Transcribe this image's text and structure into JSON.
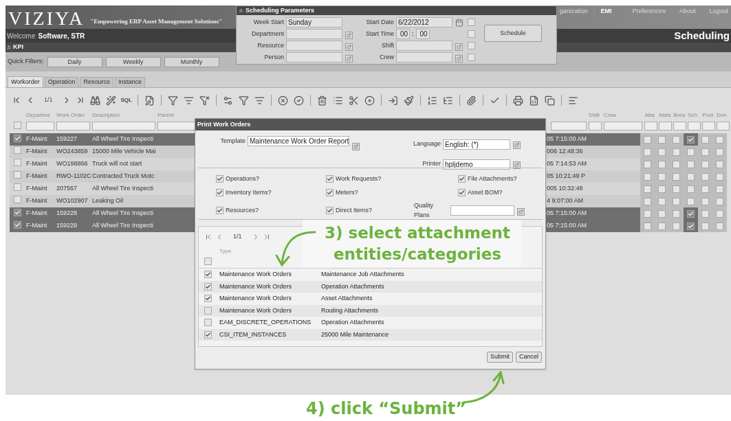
{
  "header": {
    "logo": "VIZIYA",
    "tagline": "\"Empowering ERP Asset Management Solutions\"",
    "org_label": "ganization",
    "org_separator": ":",
    "org_value": "EMI",
    "links": [
      "Preferences",
      "About",
      "Logout"
    ]
  },
  "welcome": {
    "label": "Welcome",
    "user": "Software, STR",
    "module": "Scheduling"
  },
  "kpi": {
    "label": "KPI"
  },
  "quick_filters": {
    "label": "Quick Filters:",
    "buttons": [
      "Daily",
      "Weekly",
      "Monthly"
    ]
  },
  "tabs": [
    {
      "label": "Workorder",
      "selected": true
    },
    {
      "label": "Operation",
      "selected": false
    },
    {
      "label": "Resource",
      "selected": false
    },
    {
      "label": "Instance",
      "selected": false
    }
  ],
  "toolbar": {
    "page": "1/1",
    "sql": "SQL"
  },
  "grid": {
    "columns_left": [
      "Departme",
      "Work Order",
      "Description",
      "Parent"
    ],
    "columns_right": [
      "Shift",
      "Crew"
    ],
    "flag_columns": [
      "Atta",
      "Mats",
      "Brea",
      "Sch",
      "Post",
      "Don"
    ],
    "select_all_checked": false,
    "rows": [
      {
        "selected": true,
        "department": "F-Maint",
        "work_order": "159227",
        "description": "All Wheel Tire Inspecti",
        "end_date": "05 7:15:00 AM",
        "flags": [
          false,
          false,
          false,
          true,
          false,
          false
        ]
      },
      {
        "selected": false,
        "department": "F-Maint",
        "work_order": "WO243859",
        "description": "15000 Mile Vehicle Mai",
        "end_date": "006 12:48:36",
        "flags": [
          false,
          false,
          false,
          false,
          false,
          false
        ]
      },
      {
        "selected": false,
        "department": "F-Maint",
        "work_order": "WO198866",
        "description": "Truck will not start",
        "end_date": "05 7:14:53 AM",
        "flags": [
          false,
          false,
          false,
          false,
          false,
          false
        ]
      },
      {
        "selected": false,
        "department": "F-Maint",
        "work_order": "RWO-1102C",
        "description": "Contracted Truck Motc",
        "end_date": "05 10:21:49 P",
        "flags": [
          false,
          false,
          false,
          false,
          false,
          false
        ]
      },
      {
        "selected": false,
        "department": "F-Maint",
        "work_order": "207567",
        "description": "All Wheel Tire Inspecti",
        "end_date": "005 10:32:48",
        "flags": [
          false,
          false,
          false,
          false,
          false,
          false
        ]
      },
      {
        "selected": false,
        "department": "F-Maint",
        "work_order": "WO102907",
        "description": "Leaking Oil",
        "end_date": "4 9:07:00 AM",
        "flags": [
          false,
          false,
          false,
          false,
          false,
          false
        ]
      },
      {
        "selected": true,
        "department": "F-Maint",
        "work_order": "159228",
        "description": "All Wheel Tire Inspecti",
        "end_date": "05 7:15:00 AM",
        "flags": [
          false,
          false,
          false,
          true,
          false,
          false
        ]
      },
      {
        "selected": true,
        "department": "F-Maint",
        "work_order": "159229",
        "description": "All Wheel Tire Inspecti",
        "end_date": "05 7:15:00 AM",
        "flags": [
          false,
          false,
          false,
          true,
          false,
          false
        ]
      }
    ]
  },
  "scheduling_parameters": {
    "title": "Scheduling Parameters",
    "left_fields": [
      {
        "label": "Week Start",
        "kind": "text",
        "value": "Sunday"
      },
      {
        "label": "Department",
        "kind": "lookup"
      },
      {
        "label": "Resource",
        "kind": "lookup"
      },
      {
        "label": "Person",
        "kind": "lookup"
      }
    ],
    "right_fields": [
      {
        "label": "Start Date",
        "kind": "date",
        "value": "6/22/2012",
        "checked": false
      },
      {
        "label": "Start Time",
        "kind": "time",
        "hours": "00",
        "separator": ":",
        "minutes": "00",
        "checked": false
      },
      {
        "label": "Shift",
        "kind": "lookup",
        "checked": false
      },
      {
        "label": "Crew",
        "kind": "lookup",
        "checked": false
      }
    ],
    "button": "Schedule"
  },
  "print_dialog": {
    "title": "Print Work Orders",
    "template": {
      "label": "Template",
      "value": "Maintenance Work Order Report"
    },
    "language": {
      "label": "Language",
      "value": "English: (*)"
    },
    "printer": {
      "label": "Printer",
      "value": "hpljdemo"
    },
    "options": [
      {
        "label": "Operations?",
        "checked": true
      },
      {
        "label": "Work Requests?",
        "checked": true
      },
      {
        "label": "File Attachments?",
        "checked": true
      },
      {
        "label": "Inventory Items?",
        "checked": true
      },
      {
        "label": "Meters?",
        "checked": true
      },
      {
        "label": "Asset BOM?",
        "checked": true
      },
      {
        "label": "Resources?",
        "checked": true
      },
      {
        "label": "Direct Items?",
        "checked": true
      }
    ],
    "quality_plans": {
      "label": "Quality Plans"
    },
    "attachments": {
      "page": "1/1",
      "type_header": "Type",
      "all_checked": false,
      "rows": [
        {
          "checked": true,
          "type": "Maintenance Work Orders",
          "category": "Maintenance Job Attachments"
        },
        {
          "checked": true,
          "type": "Maintenance Work Orders",
          "category": "Operation Attachments"
        },
        {
          "checked": true,
          "type": "Maintenance Work Orders",
          "category": "Asset Attachments"
        },
        {
          "checked": false,
          "type": "Maintenance Work Orders",
          "category": "Routing Attachments"
        },
        {
          "checked": false,
          "type": "EAM_DISCRETE_OPERATIONS",
          "category": "Operation Attachments"
        },
        {
          "checked": true,
          "type": "CSI_ITEM_INSTANCES",
          "category": "25000 Mile Maintenance"
        }
      ]
    },
    "buttons": [
      "Submit",
      "Cancel"
    ]
  },
  "annotations": [
    {
      "text": "3) select attachment entities/categories"
    },
    {
      "text": "4) click “Submit”"
    }
  ]
}
